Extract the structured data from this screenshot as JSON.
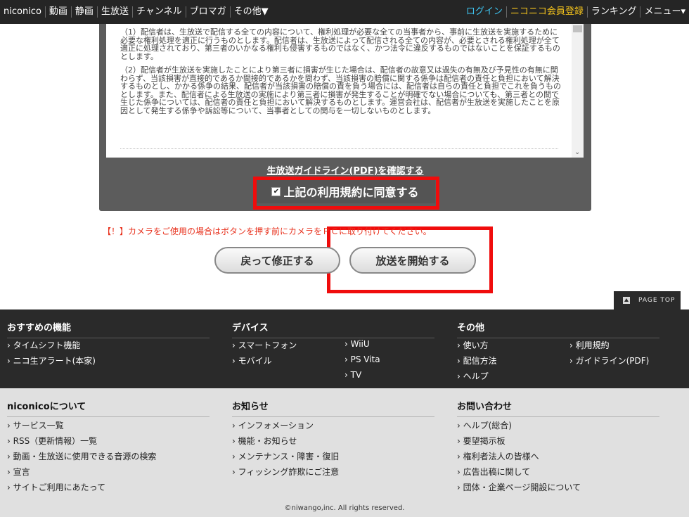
{
  "topnav": {
    "left": [
      "niconico",
      "動画",
      "静画",
      "生放送",
      "チャンネル",
      "ブロマガ",
      "その他▼"
    ],
    "right": [
      "ログイン",
      "ニコニコ会員登録",
      "ランキング",
      "メニュー▾"
    ]
  },
  "terms": {
    "p1": "（1）配信者は、生放送で配信する全ての内容について、権利処理が必要な全ての当事者から、事前に生放送を実施するために必要な権利処理を適正に行うものとします。配信者は、生放送によって配信される全ての内容が、必要とされる権利処理が全て適正に処理されており、第三者のいかなる権利も侵害するものではなく、かつ法令に違反するものではないことを保証するものとします。",
    "p2": "（2）配信者が生放送を実施したことにより第三者に損害が生じた場合は、配信者の故意又は過失の有無及び予見性の有無に関わらず、当該損害が直接的であるか間接的であるかを問わず、当該損害の賠償に関する係争は配信者の責任と負担において解決するものとし、かかる係争の結果、配信者が当該損害の賠償の責を負う場合には、配信者は自らの責任と負担でこれを負うものとします。また、配信者による生放送の実施により第三者に損害が発生することが明確でない場合についても、第三者との間で生じた係争については、配信者の責任と負担において解決するものとします。運営会社は、配信者が生放送を実施したことを原因として発生する係争や訴訟等について、当事者としての関与を一切しないものとします。"
  },
  "guideline_link": "生放送ガイドライン(PDF)を確認する",
  "agree": {
    "check": "✔",
    "label": "上記の利用規約に同意する"
  },
  "warning": "【！】カメラをご使用の場合はボタンを押す前にカメラをＰＣに取り付けてください。",
  "buttons": {
    "back": "戻って修正する",
    "start": "放送を開始する"
  },
  "page_top": "PAGE TOP",
  "footer_dark": {
    "col1": {
      "title": "おすすめの機能",
      "links": [
        "› タイムシフト機能",
        "› ニコ生アラート(本家)"
      ]
    },
    "col2": {
      "title": "デバイス",
      "links_a": [
        "› スマートフォン",
        "› モバイル"
      ],
      "links_b": [
        "› WiiU",
        "› PS Vita",
        "› TV"
      ]
    },
    "col3": {
      "title": "その他",
      "links_a": [
        "› 使い方",
        "› 配信方法",
        "› ヘルプ"
      ],
      "links_b": [
        "› 利用規約",
        "› ガイドライン(PDF)"
      ]
    }
  },
  "footer_light": {
    "col1": {
      "title": "niconicoについて",
      "links": [
        "› サービス一覧",
        "› RSS（更新情報）一覧",
        "› 動画・生放送に使用できる音源の検索",
        "› 宣言",
        "› サイトご利用にあたって"
      ]
    },
    "col2": {
      "title": "お知らせ",
      "links": [
        "› インフォメーション",
        "› 機能・お知らせ",
        "› メンテナンス・障害・復旧",
        "› フィッシング詐欺にご注意"
      ]
    },
    "col3": {
      "title": "お問い合わせ",
      "links": [
        "› ヘルプ(総合)",
        "› 要望掲示板",
        "› 権利者法人の皆様へ",
        "› 広告出稿に関して",
        "› 団体・企業ページ開設について"
      ]
    }
  },
  "copyright": "©niwango,inc. All rights reserved.",
  "colors": {
    "highlight": "#f00c0c",
    "login": "#3ec4f0",
    "member": "#f3c21c",
    "warning": "#e8321e"
  }
}
